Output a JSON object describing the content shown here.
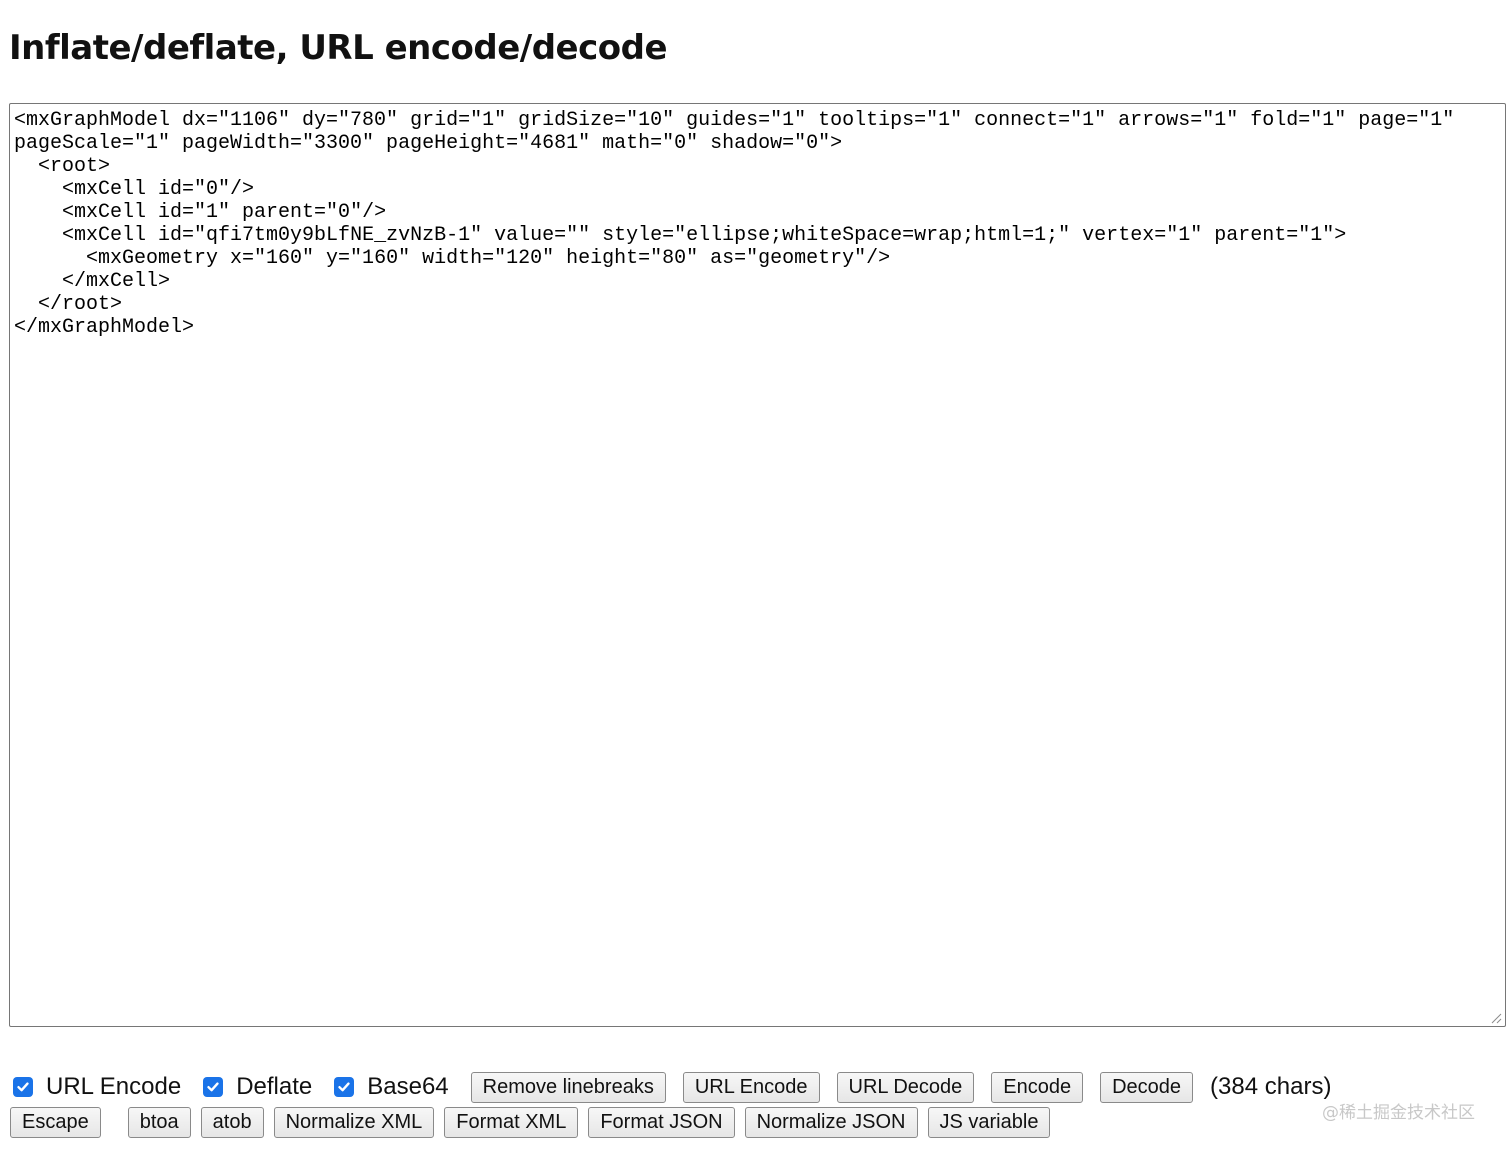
{
  "page": {
    "title": "Inflate/deflate, URL encode/decode"
  },
  "editor": {
    "content": "<mxGraphModel dx=\"1106\" dy=\"780\" grid=\"1\" gridSize=\"10\" guides=\"1\" tooltips=\"1\" connect=\"1\" arrows=\"1\" fold=\"1\" page=\"1\"\npageScale=\"1\" pageWidth=\"3300\" pageHeight=\"4681\" math=\"0\" shadow=\"0\">\n  <root>\n    <mxCell id=\"0\"/>\n    <mxCell id=\"1\" parent=\"0\"/>\n    <mxCell id=\"qfi7tm0y9bLfNE_zvNzB-1\" value=\"\" style=\"ellipse;whiteSpace=wrap;html=1;\" vertex=\"1\" parent=\"1\">\n      <mxGeometry x=\"160\" y=\"160\" width=\"120\" height=\"80\" as=\"geometry\"/>\n    </mxCell>\n  </root>\n</mxGraphModel>"
  },
  "options": [
    {
      "label": "URL Encode",
      "checked": true
    },
    {
      "label": "Deflate",
      "checked": true
    },
    {
      "label": "Base64",
      "checked": true
    }
  ],
  "row1_buttons": [
    "Remove linebreaks",
    "URL Encode",
    "URL Decode",
    "Encode",
    "Decode"
  ],
  "char_count": "(384 chars)",
  "row2_buttons": [
    "Escape",
    "btoa",
    "atob",
    "Normalize XML",
    "Format XML",
    "Format JSON",
    "Normalize JSON",
    "JS variable"
  ],
  "watermark": "@稀土掘金技术社区",
  "colors": {
    "checkbox_accent": "#1a73e8",
    "button_border": "#8a8a8a",
    "textarea_border": "#767676"
  }
}
